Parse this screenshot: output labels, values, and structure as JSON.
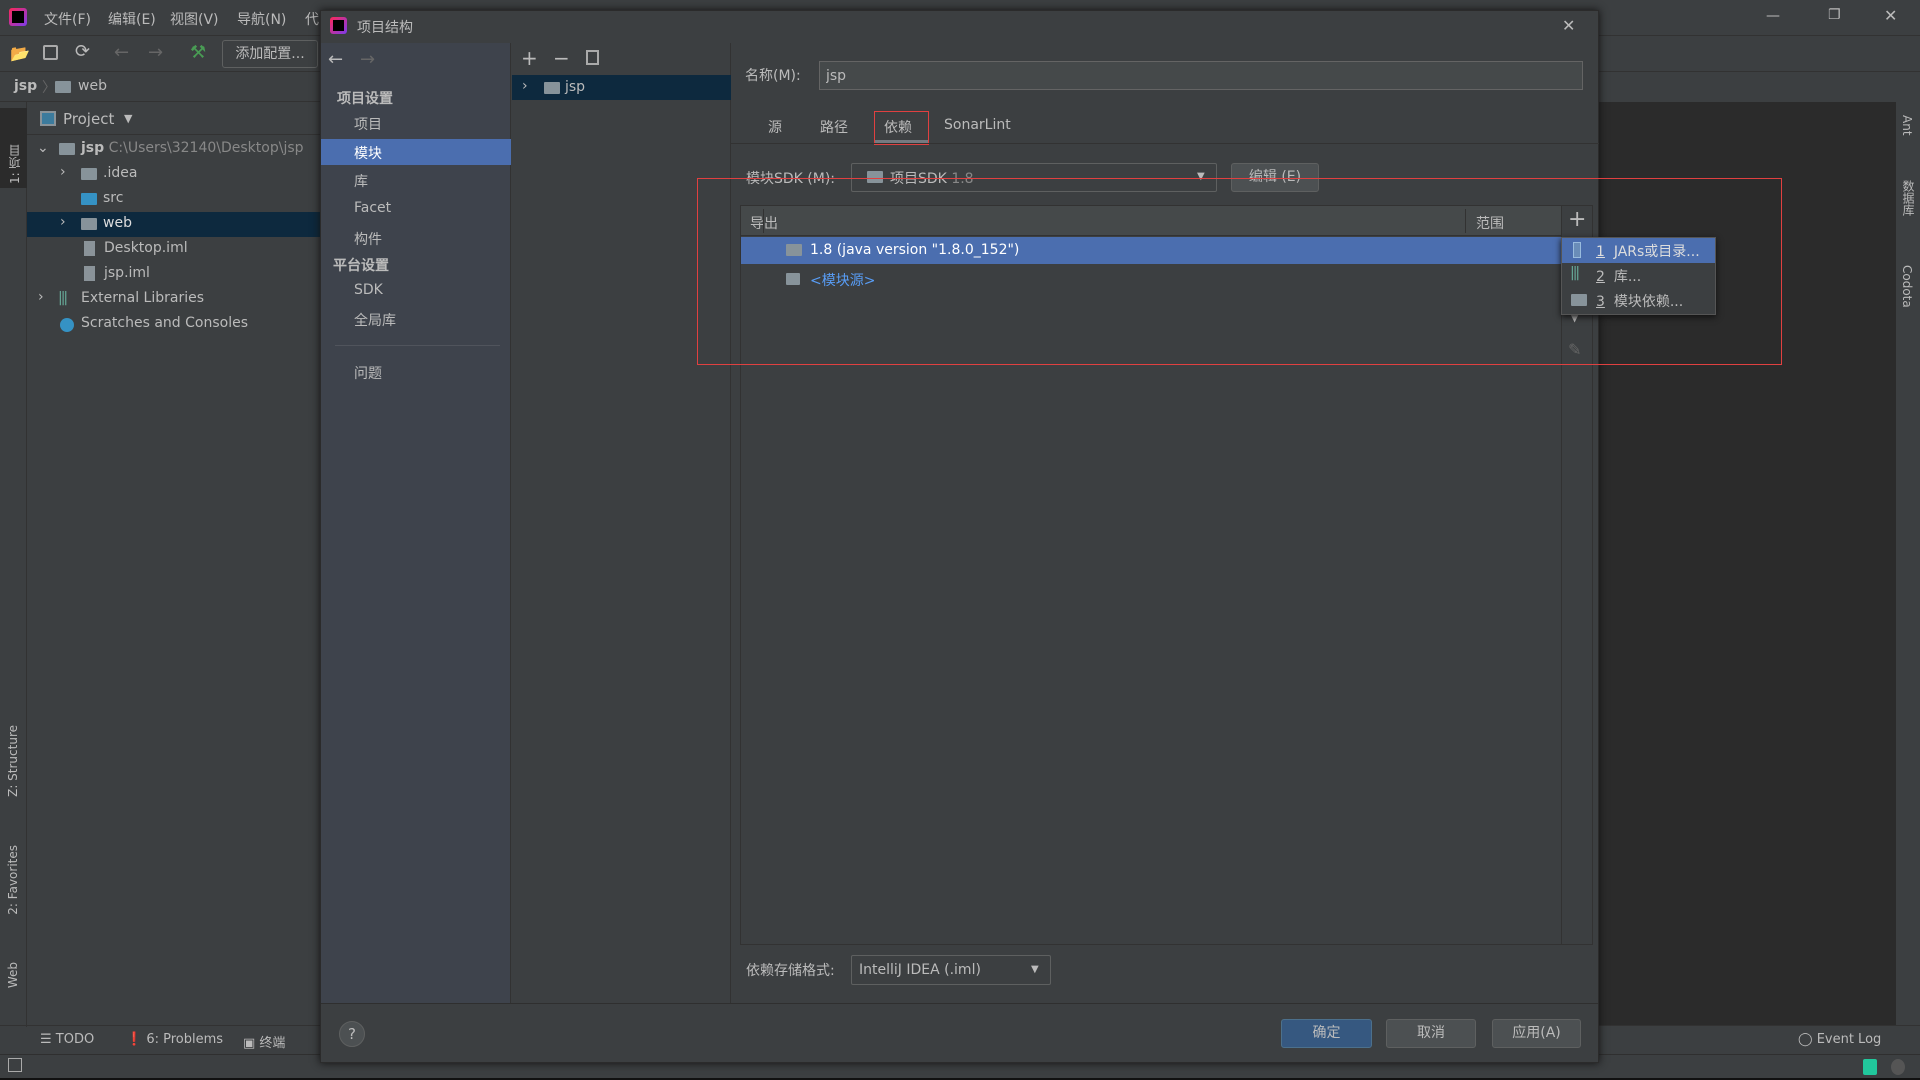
{
  "ide": {
    "menu": [
      "文件(F)",
      "编辑(E)",
      "视图(V)",
      "导航(N)",
      "代"
    ],
    "toolbar": {
      "add_config": "添加配置..."
    },
    "breadcrumb": [
      "jsp",
      "web"
    ],
    "project_panel": {
      "title": "Project",
      "tree": [
        {
          "label": "jsp",
          "path": "C:\\Users\\32140\\Desktop\\jsp",
          "icon": "module-folder-icon",
          "expanded": true
        },
        {
          "label": ".idea",
          "icon": "folder-icon"
        },
        {
          "label": "src",
          "icon": "source-folder-icon"
        },
        {
          "label": "web",
          "icon": "web-folder-icon",
          "selected": true
        },
        {
          "label": "Desktop.iml",
          "icon": "iml-file-icon"
        },
        {
          "label": "jsp.iml",
          "icon": "iml-file-icon"
        },
        {
          "label": "External Libraries",
          "icon": "libraries-icon"
        },
        {
          "label": "Scratches and Consoles",
          "icon": "scratches-icon"
        }
      ]
    },
    "left_stripe": [
      "1: 项目",
      "Z: Structure",
      "2: Favorites",
      "Web"
    ],
    "right_stripe": [
      "Ant",
      "数据库",
      "Codota"
    ],
    "bottom_tools": [
      "TODO",
      "6: Problems",
      "终端"
    ],
    "event_log": "Event Log"
  },
  "dialog": {
    "title": "项目结构",
    "nav": {
      "heading_project": "项目设置",
      "project_items": [
        "项目",
        "模块",
        "库",
        "Facet",
        "构件"
      ],
      "heading_platform": "平台设置",
      "platform_items": [
        "SDK",
        "全局库"
      ],
      "problems": "问题",
      "selected": "模块"
    },
    "modules": [
      "jsp"
    ],
    "name_label": "名称(M):",
    "name_value": "jsp",
    "tabs": [
      "源",
      "路径",
      "依赖",
      "SonarLint"
    ],
    "active_tab": "依赖",
    "sdk_label": "模块SDK (M):",
    "sdk_value": "项目SDK",
    "sdk_version": "1.8",
    "edit_button": "编辑 (E)",
    "table": {
      "col_export": "导出",
      "col_scope": "范围",
      "rows": [
        {
          "label": "1.8 (java version \"1.8.0_152\")",
          "selected": true
        },
        {
          "label": "<模块源>"
        }
      ]
    },
    "add_menu": [
      {
        "num": "1",
        "label": "JARs或目录..."
      },
      {
        "num": "2",
        "label": "库..."
      },
      {
        "num": "3",
        "label": "模块依赖..."
      }
    ],
    "storage_label": "依赖存储格式:",
    "storage_value": "IntelliJ IDEA (.iml)",
    "ok": "确定",
    "cancel": "取消",
    "apply": "应用(A)",
    "help": "?"
  },
  "colors": {
    "accent": "#4b6eaf",
    "highlight_box": "#e04040",
    "link": "#589df6"
  }
}
